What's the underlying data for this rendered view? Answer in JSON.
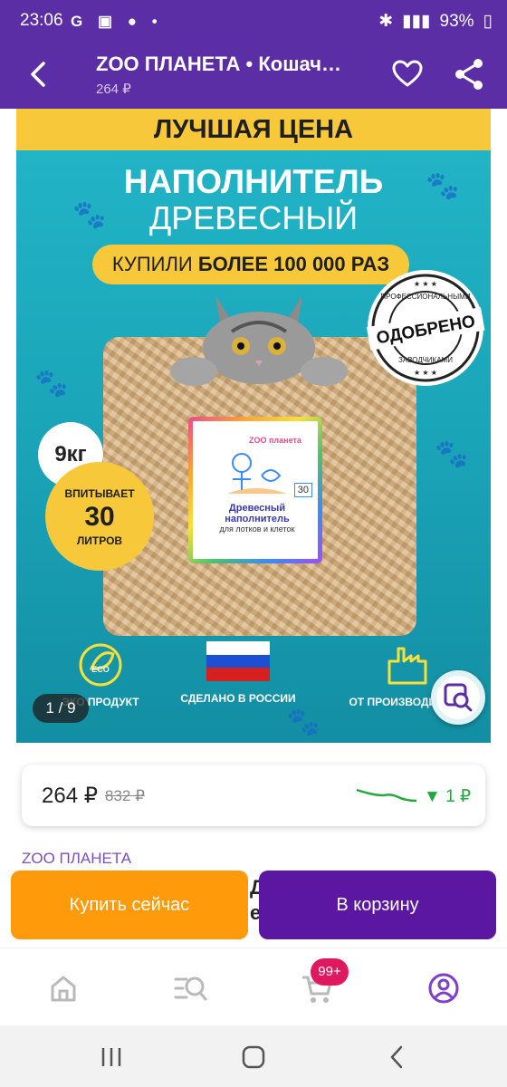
{
  "status_bar": {
    "time": "23:06",
    "left_icons": "G",
    "battery": "93%"
  },
  "app_bar": {
    "title": "ZOO ПЛАНЕТА • Кошач…",
    "subtitle": "264 ₽"
  },
  "product_image": {
    "top_banner": "ЛУЧШАЯ ЦЕНА",
    "headline": "НАПОЛНИТЕЛЬ",
    "headline2": "ДРЕВЕСНЫЙ",
    "pill_prefix": "КУПИЛИ",
    "pill_bold": "БОЛЕЕ 100 000 РАЗ",
    "seal_top": "ПРОФЕССИОНАЛЬНЫМИ",
    "seal_main": "ОДОБРЕНО",
    "seal_bottom": "ЗАВОДЧИКАМИ",
    "weight": "9кг",
    "absorb_top": "ВПИТЫВАЕТ",
    "absorb_value": "30",
    "absorb_bottom": "ЛИТРОВ",
    "package_brand": "ZOO планета",
    "package_text": "Древесный наполнитель",
    "package_sub": "для лотков и клеток",
    "package_volume": "30",
    "feature_1": "ЭКО ПРОДУКТ",
    "feature_1_icon": "ECO",
    "feature_2": "СДЕЛАНО В РОССИИ",
    "feature_3": "ОТ ПРОИЗВОДИТЕЛЯ",
    "counter": "1 / 9"
  },
  "price_card": {
    "price": "264 ₽",
    "old_price": "832 ₽",
    "price_drop": "1 ₽",
    "colors": {
      "drop": "#1faa3b"
    }
  },
  "seller": "ZOO ПЛАНЕТА",
  "actions": {
    "buy_now": "Купить сейчас",
    "add_to_cart": "В корзину",
    "peek_text": "Д е"
  },
  "bottom_nav": {
    "cart_badge": "99+",
    "icons": [
      "home-icon",
      "catalog-search-icon",
      "cart-icon",
      "profile-icon"
    ]
  },
  "colors": {
    "brand": "#5b2ea6",
    "buy": "#ff9a0a",
    "cart": "#5b17a1",
    "badge": "#e0195e"
  }
}
